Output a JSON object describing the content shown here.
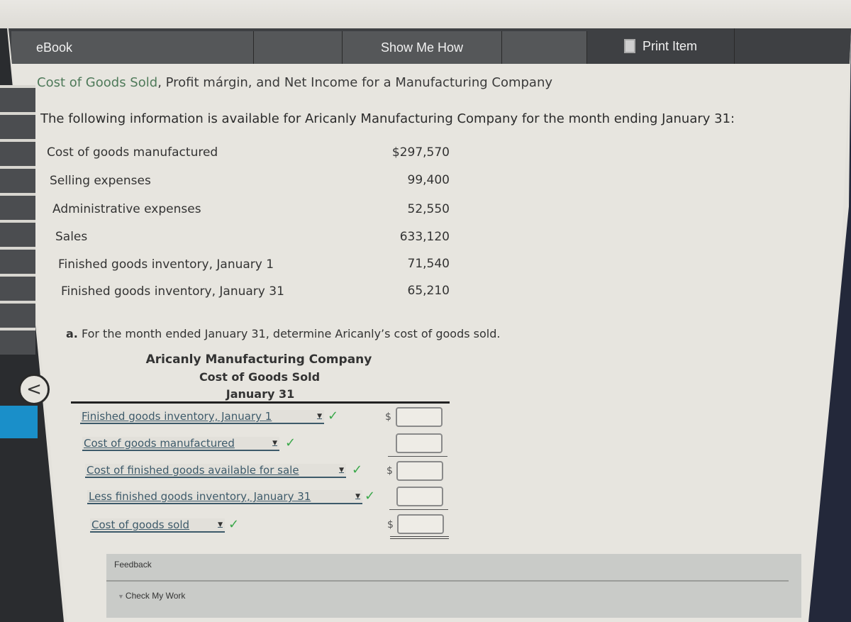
{
  "tabs": [
    {
      "label": "eBook",
      "icon": null
    },
    {
      "label": "",
      "icon": null
    },
    {
      "label": "Show Me How",
      "icon": null
    },
    {
      "label": "",
      "icon": null
    },
    {
      "label": "Print Item",
      "icon": "print-icon"
    },
    {
      "label": "",
      "icon": null
    }
  ],
  "question": {
    "title_link": "Cost of Goods Sold",
    "title_rest": ", Profit márgin, and Net Income for a Manufacturing Company",
    "intro": "The following information is available for Aricanly Manufacturing Company for the month ending January 31:",
    "given": [
      {
        "label": "Cost of goods manufactured",
        "value": "$297,570"
      },
      {
        "label": "Selling expenses",
        "value": "99,400"
      },
      {
        "label": "Administrative expenses",
        "value": "52,550"
      },
      {
        "label": "Sales",
        "value": "633,120"
      },
      {
        "label": "Finished goods inventory, January 1",
        "value": "71,540"
      },
      {
        "label": "Finished goods inventory, January 31",
        "value": "65,210"
      }
    ],
    "part_a_prefix": "a.",
    "part_a_text": " For the month ended January 31, determine Aricanly’s cost of goods sold."
  },
  "statement": {
    "company": "Aricanly Manufacturing Company",
    "title": "Cost of Goods Sold",
    "date": "January 31",
    "rows": [
      {
        "selected": "Finished goods inventory, January 1",
        "status": "correct",
        "currency": "$",
        "amount": ""
      },
      {
        "selected": "Cost of goods manufactured",
        "status": "correct",
        "currency": "",
        "amount": ""
      },
      {
        "selected": "Cost of finished goods available for sale",
        "status": "correct",
        "currency": "$",
        "amount": ""
      },
      {
        "selected": "Less finished goods inventory, January 31",
        "status": "correct",
        "currency": "",
        "amount": ""
      },
      {
        "selected": "Cost of goods sold",
        "status": "correct",
        "currency": "$",
        "amount": ""
      }
    ],
    "check_glyph": "✓",
    "caret_glyph": "▼"
  },
  "feedback": {
    "label": "Feedback",
    "toggle_label": "Check My Work",
    "toggle_glyph": "▼"
  },
  "nav": {
    "back_glyph": "<"
  },
  "colors": {
    "toolbar": "#3e4043",
    "link_green": "#4f7a5a",
    "check_green": "#3aa84a",
    "dropdown_text": "#3d5a6a",
    "sidebar_active": "#1a8fc9"
  }
}
